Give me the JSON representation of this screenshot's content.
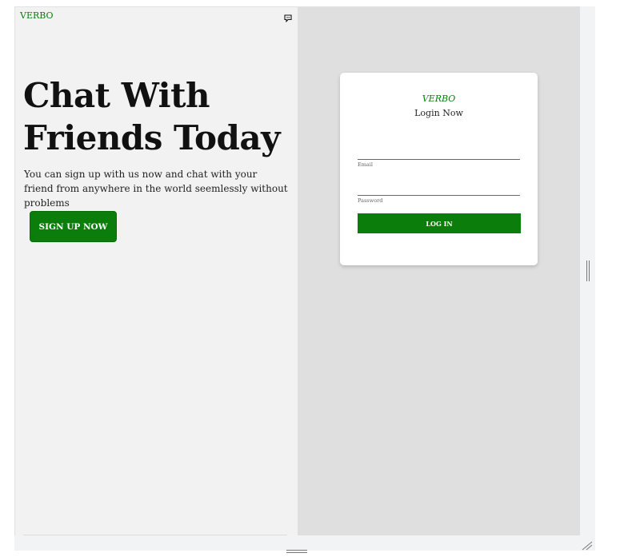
{
  "header": {
    "brand": "VERBO",
    "chat_icon": "chat-bubble-icon"
  },
  "hero": {
    "headline": "Chat With Friends Today",
    "subtext": "You can sign up with us now and chat with your friend from anywhere in the world seemlessly without problems",
    "signup_label": "SIGN UP NOW"
  },
  "login": {
    "brand": "VERBO",
    "title": "Login Now",
    "email_label": "Email",
    "email_value": "",
    "password_label": "Password",
    "password_value": "",
    "submit_label": "LOG IN"
  },
  "colors": {
    "brand_green": "#0a7d0a",
    "left_bg": "#f2f2f2",
    "right_bg": "#dfdfdf",
    "card_bg": "#ffffff"
  },
  "chrome": {
    "vertical_resize_icon": "vertical-resize-handle-icon",
    "horizontal_resize_icon": "horizontal-resize-handle-icon",
    "corner_resize_icon": "corner-resize-icon"
  }
}
